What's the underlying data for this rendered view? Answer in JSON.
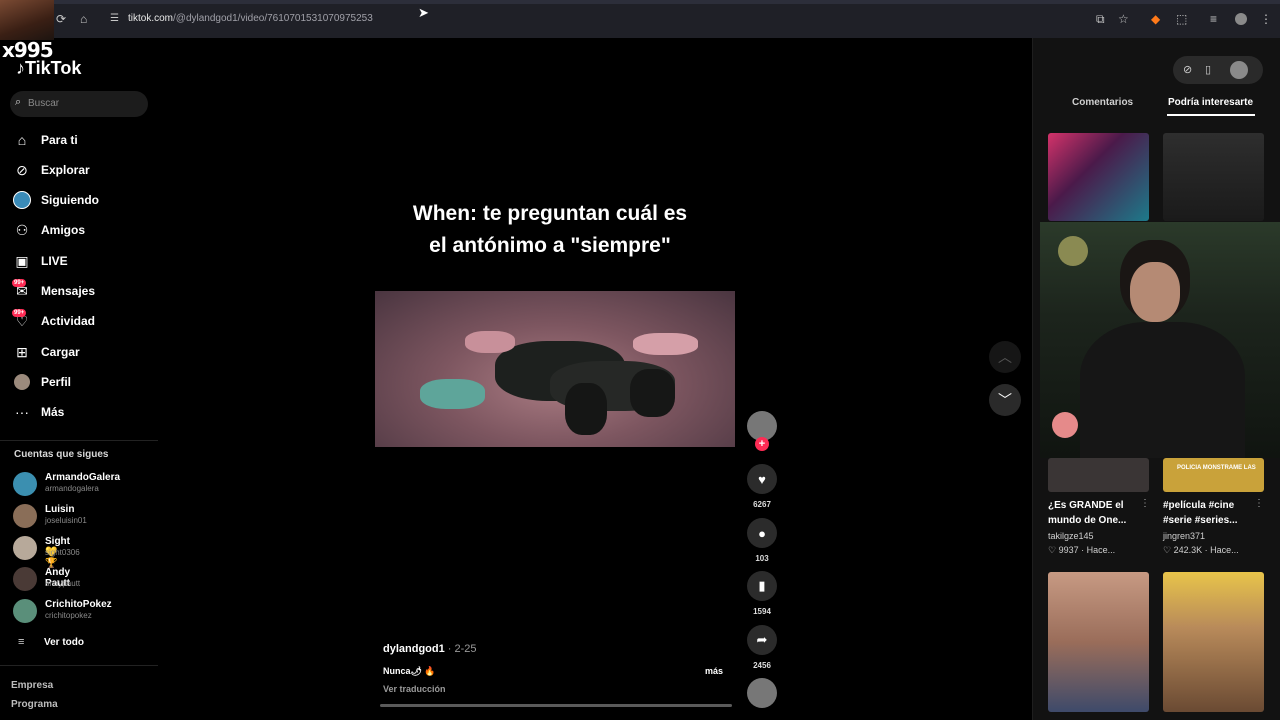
{
  "browser": {
    "url_host": "tiktok.com",
    "url_path": "/@dylandgod1/video/7610701531070975253"
  },
  "overlay": {
    "score_text": "x995"
  },
  "app": {
    "logo": "TikTok"
  },
  "search": {
    "placeholder": "Buscar"
  },
  "nav": [
    {
      "label": "Para ti",
      "icon": "home-icon"
    },
    {
      "label": "Explorar",
      "icon": "compass-icon"
    },
    {
      "label": "Siguiendo",
      "icon": "following-icon"
    },
    {
      "label": "Amigos",
      "icon": "friends-icon"
    },
    {
      "label": "LIVE",
      "icon": "live-icon"
    },
    {
      "label": "Mensajes",
      "icon": "messages-icon",
      "badge": "99+"
    },
    {
      "label": "Actividad",
      "icon": "activity-icon",
      "badge": "99+"
    },
    {
      "label": "Cargar",
      "icon": "upload-icon"
    },
    {
      "label": "Perfil",
      "icon": "profile-icon"
    },
    {
      "label": "Más",
      "icon": "more-icon"
    }
  ],
  "following": {
    "title": "Cuentas que sigues",
    "accounts": [
      {
        "name": "ArmandoGalera",
        "handle": "armandogalera"
      },
      {
        "name": "Luisin",
        "handle": "joseluisin01"
      },
      {
        "name": "Sight💛 🏆",
        "handle": "sight0306"
      },
      {
        "name": "Andy Pautt",
        "handle": "andypautt"
      },
      {
        "name": "CrichitoPokez",
        "handle": "crichitopokez"
      }
    ],
    "see_all": "Ver todo"
  },
  "footer": {
    "links": [
      "Empresa",
      "Programa"
    ]
  },
  "video": {
    "caption_line1": "When: te preguntan cuál es",
    "caption_line2": "el antónimo a \"siempre\"",
    "author": "dylandgod1",
    "date": " · 2-25",
    "description": "Nunca🌶 🔥",
    "more": "más",
    "translate": "Ver traducción",
    "progress": 0.0
  },
  "actions": {
    "likes": "6267",
    "comments": "103",
    "saves": "1594",
    "shares": "2456"
  },
  "panel": {
    "tabs": [
      "Comentarios",
      "Podría interesarte"
    ],
    "active_tab": "Podría interesarte",
    "cards": [
      {
        "title": "¿Es GRANDE el mundo de One...",
        "user": "takilgze145",
        "stats": "♡ 9937 · Hace..."
      },
      {
        "title": "#película #cine #serie #series...",
        "user": "jingren371",
        "stats": "♡ 242.3K · Hace...",
        "thumb_text": "POLICIA MONSTRAME LAS"
      }
    ]
  },
  "colors": {
    "accent": "#fe2c55",
    "background": "#000000",
    "panel": "#121212"
  }
}
